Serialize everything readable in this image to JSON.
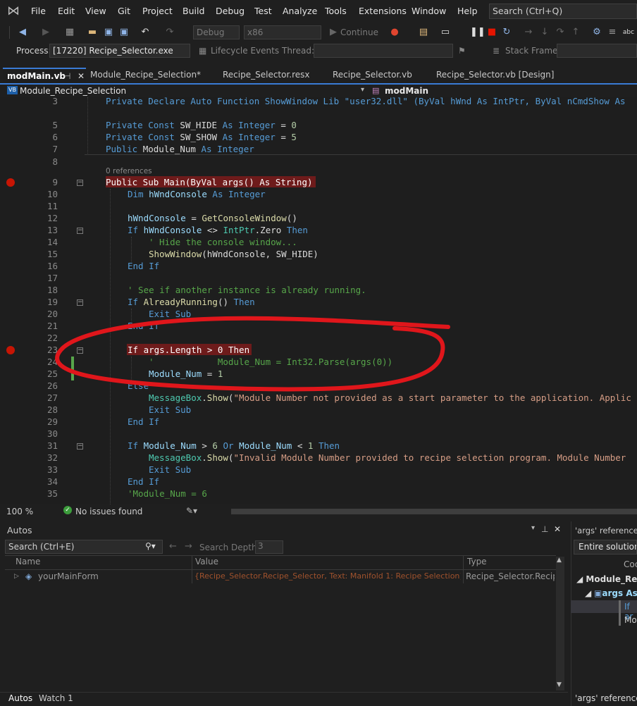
{
  "menu": {
    "items": [
      "File",
      "Edit",
      "View",
      "Git",
      "Project",
      "Build",
      "Debug",
      "Test",
      "Analyze",
      "Tools",
      "Extensions",
      "Window",
      "Help"
    ],
    "search_placeholder": "Search (Ctrl+Q)"
  },
  "toolbar": {
    "config": "Debug",
    "platform": "x86",
    "continue_label": "Continue"
  },
  "processbar": {
    "process_label": "Process:",
    "process_value": "[17220] Recipe_Selector.exe",
    "lifecycle_label": "Lifecycle Events",
    "thread_label": "Thread:",
    "stackframe_label": "Stack Frame:"
  },
  "tabs": [
    {
      "label": "modMain.vb"
    },
    {
      "label": "Module_Recipe_Selection*"
    },
    {
      "label": "Recipe_Selector.resx"
    },
    {
      "label": "Recipe_Selector.vb"
    },
    {
      "label": "Recipe_Selector.vb [Design]"
    }
  ],
  "navbar": {
    "left": "Module_Recipe_Selection",
    "right": "modMain"
  },
  "code": {
    "line_numbers": [
      "3",
      "",
      "5",
      "6",
      "7",
      "8",
      "9",
      "10",
      "11",
      "12",
      "13",
      "14",
      "15",
      "16",
      "17",
      "18",
      "19",
      "20",
      "21",
      "22",
      "23",
      "24",
      "25",
      "26",
      "27",
      "28",
      "29",
      "30",
      "31",
      "32",
      "33",
      "34",
      "35"
    ],
    "refs_label": "0 references",
    "lines": {
      "l3": "Private Declare Auto Function ShowWindow Lib \"user32.dll\" (ByVal hWnd As IntPtr, ByVal nCmdShow As",
      "l5a": "Private Const ",
      "l5b": "SW_HIDE",
      "l5c": " As ",
      "l5d": "Integer",
      "l5e": " = ",
      "l5f": "0",
      "l6a": "Private Const ",
      "l6b": "SW_SHOW",
      "l6c": " As ",
      "l6d": "Integer",
      "l6e": " = ",
      "l6f": "5",
      "l7a": "Public ",
      "l7b": "Module_Num",
      "l7c": " As ",
      "l7d": "Integer",
      "l9": "Public Sub Main(ByVal args() As String)",
      "l10a": "Dim ",
      "l10b": "hWndConsole",
      "l10c": " As ",
      "l10d": "Integer",
      "l12a": "hWndConsole",
      "l12b": " = ",
      "l12c": "GetConsoleWindow",
      "l12d": "()",
      "l13a": "If ",
      "l13b": "hWndConsole",
      "l13c": " <> ",
      "l13d": "IntPtr",
      "l13e": ".Zero ",
      "l13f": "Then",
      "l14": "' Hide the console window...",
      "l15a": "ShowWindow",
      "l15b": "(hWndConsole, SW_HIDE)",
      "l16": "End If",
      "l18": "' See if another instance is already running.",
      "l19a": "If ",
      "l19b": "AlreadyRunning",
      "l19c": "() ",
      "l19d": "Then",
      "l20": "Exit Sub",
      "l21": "End If",
      "l23": "If args.Length > 0 Then",
      "l24": "'            Module_Num = Int32.Parse(args(0))",
      "l25a": "Module_Num",
      "l25b": " = ",
      "l25c": "1",
      "l26": "Else",
      "l27a": "MessageBox",
      "l27b": ".",
      "l27c": "Show",
      "l27d": "(",
      "l27e": "\"Module Number not provided as a start parameter to the application. Applic",
      "l28": "Exit Sub",
      "l29": "End If",
      "l31a": "If ",
      "l31b": "Module_Num",
      "l31c": " > ",
      "l31d": "6",
      "l31e": " Or ",
      "l31f": "Module_Num",
      "l31g": " < ",
      "l31h": "1",
      "l31i": " Then",
      "l32a": "MessageBox",
      "l32b": ".",
      "l32c": "Show",
      "l32d": "(",
      "l32e": "\"Invalid Module Number provided to recipe selection program. Module Number",
      "l33": "Exit Sub",
      "l34": "End If",
      "l35": "'Module_Num = 6"
    }
  },
  "status": {
    "zoom": "100 %",
    "issues": "No issues found"
  },
  "autos": {
    "title": "Autos",
    "search_placeholder": "Search (Ctrl+E)",
    "search_depth_label": "Search Depth:",
    "search_depth_value": "3",
    "columns": [
      "Name",
      "Value",
      "Type"
    ],
    "rows": [
      {
        "name": "yourMainForm",
        "value": "{Recipe_Selector.Recipe_Selector, Text: Manifold 1: Recipe Selection}",
        "type": "Recipe_Selector.Recip..."
      }
    ],
    "bottom_tabs": [
      "Autos",
      "Watch 1"
    ]
  },
  "refs": {
    "title": "'args' references -",
    "scope": "Entire solution",
    "col": "Coc",
    "tree": [
      "Module_Reci",
      "args As",
      "If ar",
      "Mo"
    ],
    "bottom_tab": "'args' references"
  },
  "annotation_color": "#e0161b"
}
